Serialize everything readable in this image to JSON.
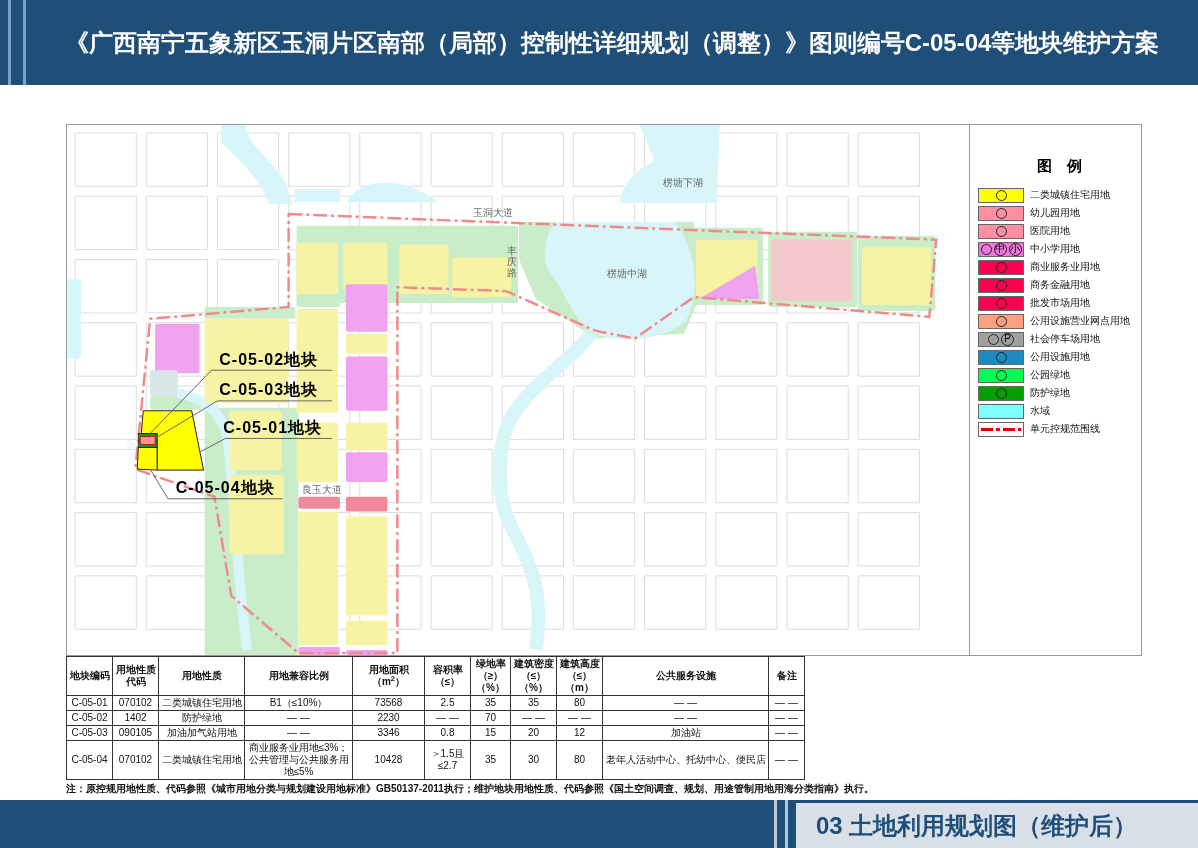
{
  "header": {
    "title": "《广西南宁五象新区玉洞片区南部（局部）控制性详细规划（调整）》图则编号C-05-04等地块维护方案"
  },
  "map": {
    "place_labels": [
      {
        "kind": "horizontal",
        "text": "楞塘下湖"
      },
      {
        "kind": "horizontal",
        "text": "玉洞大道"
      },
      {
        "kind": "vertical",
        "text": "丰庆路"
      },
      {
        "kind": "horizontal",
        "text": "楞塘中湖"
      },
      {
        "kind": "horizontal",
        "text": "良玉大道"
      }
    ],
    "parcel_labels": [
      {
        "text": "C-05-02地块"
      },
      {
        "text": "C-05-03地块"
      },
      {
        "text": "C-05-01地块"
      },
      {
        "text": "C-05-04地块"
      }
    ]
  },
  "legend": {
    "title": "图 例",
    "items": [
      {
        "kind": "zone",
        "color": "#ffff00",
        "label": "二类城镇住宅用地"
      },
      {
        "kind": "zone",
        "color": "#ff8fa3",
        "label": "幼儿园用地"
      },
      {
        "kind": "zone",
        "color": "#ff8fa3",
        "label": "医院用地"
      },
      {
        "kind": "zone",
        "color": "#ee77dd",
        "label": "中小学用地",
        "marks": [
          "中",
          "小"
        ]
      },
      {
        "kind": "zone",
        "color": "#ff0050",
        "label": "商业服务业用地"
      },
      {
        "kind": "zone",
        "color": "#ff0050",
        "label": "商务金融用地"
      },
      {
        "kind": "zone",
        "color": "#ff0050",
        "label": "批发市场用地"
      },
      {
        "kind": "zone",
        "color": "#ff9f80",
        "label": "公用设施营业网点用地"
      },
      {
        "kind": "zone",
        "color": "#a0a0a0",
        "label": "社会停车场用地",
        "marks": [
          "P"
        ]
      },
      {
        "kind": "zone",
        "color": "#1a8cc0",
        "label": "公用设施用地"
      },
      {
        "kind": "zone",
        "color": "#00ff55",
        "label": "公园绿地"
      },
      {
        "kind": "zone",
        "color": "#00a000",
        "label": "防护绿地"
      },
      {
        "kind": "plain",
        "color": "#80ffff",
        "label": "水域"
      },
      {
        "kind": "line",
        "color": "#e00000",
        "label": "单元控规范围线"
      }
    ]
  },
  "table": {
    "columns": [
      {
        "lines": [
          "地块编码"
        ]
      },
      {
        "lines": [
          "用地性质",
          "代码"
        ]
      },
      {
        "lines": [
          "用地性质"
        ]
      },
      {
        "lines": [
          "用地兼容比例"
        ]
      },
      {
        "lines": [
          "用地面积（m$^{2}$）"
        ]
      },
      {
        "lines": [
          "容积率",
          "（≤）"
        ]
      },
      {
        "lines": [
          "绿地率",
          "（≥）",
          "（%）"
        ]
      },
      {
        "lines": [
          "建筑密度",
          "（≤）",
          "（%）"
        ]
      },
      {
        "lines": [
          "建筑高度",
          "（≤）",
          "（m）"
        ]
      },
      {
        "lines": [
          "公共服务设施"
        ]
      },
      {
        "lines": [
          "备注"
        ]
      }
    ],
    "rows": [
      [
        "C-05-01",
        "070102",
        "二类城镇住宅用地",
        "B1（≤10%）",
        "73568",
        "2.5",
        "35",
        "35",
        "80",
        "— —",
        "— —"
      ],
      [
        "C-05-02",
        "1402",
        "防护绿地",
        "— —",
        "2230",
        "— —",
        "70",
        "— —",
        "— —",
        "— —",
        "— —"
      ],
      [
        "C-05-03",
        "090105",
        "加油加气站用地",
        "— —",
        "3346",
        "0.8",
        "15",
        "20",
        "12",
        "加油站",
        "— —"
      ],
      [
        "C-05-04",
        "070102",
        "二类城镇住宅用地",
        "商业服务业用地≤3%；公共管理与公共服务用地≤5%",
        "10428",
        "＞1.5且≤2.7",
        "35",
        "30",
        "80",
        "老年人活动中心、托幼中心、便民店",
        "— —"
      ]
    ]
  },
  "note": "注：原控规用地性质、代码参照《城市用地分类与规划建设用地标准》GB50137-2011执行；维护地块用地性质、代码参照《国土空间调查、规划、用途管制用地用海分类指南》执行。",
  "footer": {
    "title": "03 土地利用规划图（维护后）"
  }
}
